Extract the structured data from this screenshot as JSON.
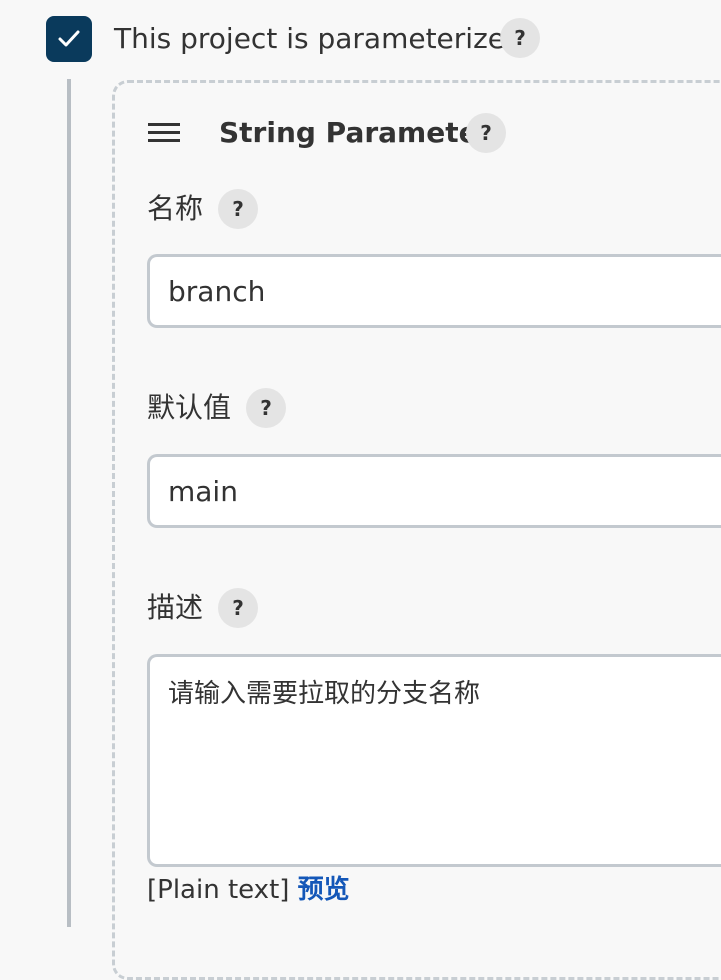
{
  "parameterized": {
    "checked": true,
    "label": "This project is parameterized",
    "help": "?"
  },
  "string_parameter": {
    "title": "String Parameter",
    "help": "?",
    "drag_icon": "hamburger-icon",
    "name": {
      "label": "名称",
      "help": "?",
      "value": "branch"
    },
    "default_value": {
      "label": "默认值",
      "help": "?",
      "value": "main"
    },
    "description": {
      "label": "描述",
      "help": "?",
      "value": "请输入需要拉取的分支名称",
      "syntax": "[Plain text]",
      "preview_label": "预览"
    }
  },
  "colors": {
    "checkbox_fill": "#0a3a5c",
    "link": "#1457b8",
    "help_badge": "#e4e4e4",
    "background": "#f8f8f8"
  }
}
